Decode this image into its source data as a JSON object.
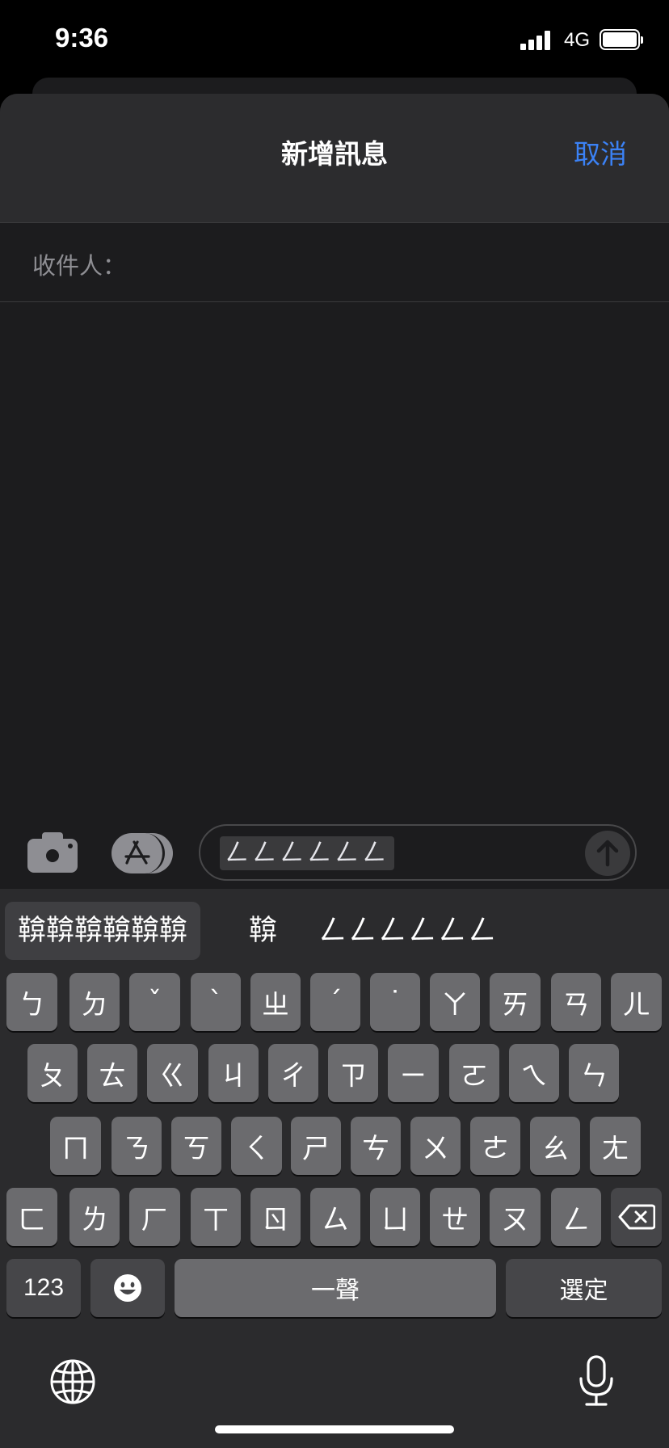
{
  "status_bar": {
    "time": "9:36",
    "network": "4G"
  },
  "sheet": {
    "title": "新增訊息",
    "cancel_label": "取消",
    "to_label": "收件人："
  },
  "compose": {
    "message_text": "ㄥㄥㄥㄥㄥㄥ"
  },
  "keyboard": {
    "suggestions": [
      "鞥鞥鞥鞥鞥鞥",
      "鞥",
      "ㄥㄥㄥㄥㄥㄥ"
    ],
    "row1": [
      "ㄅ",
      "ㄉ",
      "ˇ",
      "ˋ",
      "ㄓ",
      "ˊ",
      "˙",
      "ㄚ",
      "ㄞ",
      "ㄢ",
      "ㄦ"
    ],
    "row2": [
      "ㄆ",
      "ㄊ",
      "ㄍ",
      "ㄐ",
      "ㄔ",
      "ㄗ",
      "ㄧ",
      "ㄛ",
      "ㄟ",
      "ㄣ"
    ],
    "row3": [
      "ㄇ",
      "ㄋ",
      "ㄎ",
      "ㄑ",
      "ㄕ",
      "ㄘ",
      "ㄨ",
      "ㄜ",
      "ㄠ",
      "ㄤ"
    ],
    "row4": [
      "ㄈ",
      "ㄌ",
      "ㄏ",
      "ㄒ",
      "ㄖ",
      "ㄙ",
      "ㄩ",
      "ㄝ",
      "ㄡ",
      "ㄥ"
    ],
    "numbers_label": "123",
    "space_label": "一聲",
    "confirm_label": "選定",
    "icons": {
      "emoji": "emoji-icon",
      "backspace": "backspace-icon",
      "globe": "globe-icon",
      "mic": "microphone-icon"
    }
  },
  "colors": {
    "accent": "#3b82f6",
    "key": "#6b6b6e",
    "key_dark": "#464649",
    "keyboard_bg": "#2b2b2d",
    "sheet_bg": "#1c1c1e"
  }
}
